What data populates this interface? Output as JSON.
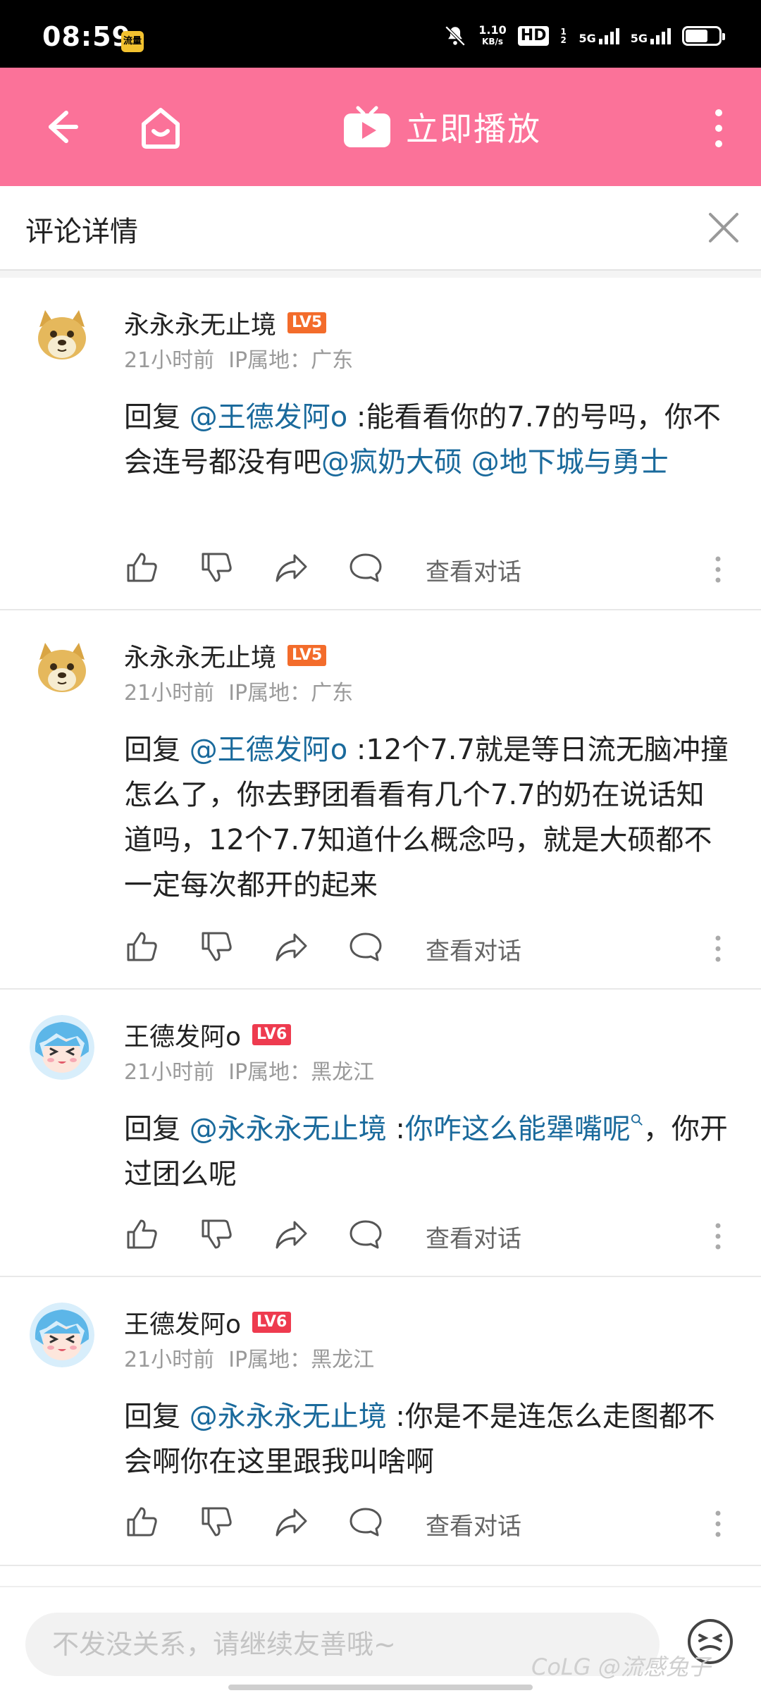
{
  "status": {
    "time": "08:59",
    "app_badge": "流量",
    "speed_value": "1.10",
    "speed_unit": "KB/s",
    "hd": "HD",
    "hd_sub": "1 2",
    "net1": "5G",
    "net2": "5G",
    "battery_level": 0.7
  },
  "app_bar": {
    "title": "立即播放",
    "background": "#fb7299"
  },
  "sub_header": {
    "title": "评论详情"
  },
  "comments": [
    {
      "username": "永永永无止境",
      "level": "LV5",
      "level_color": "#f36c2b",
      "time": "21小时前",
      "ip": "IP属地：广东",
      "reply_prefix": "回复 ",
      "mention": "@王德发阿o",
      "text_a": " :能看看你的7.7的号吗，你不会连号都没有吧",
      "mention2": "@疯奶大硕 @地下城与勇士",
      "text_b": "",
      "view_conversation": "查看对话",
      "avatar": "doge"
    },
    {
      "username": "永永永无止境",
      "level": "LV5",
      "level_color": "#f36c2b",
      "time": "21小时前",
      "ip": "IP属地：广东",
      "reply_prefix": "回复 ",
      "mention": "@王德发阿o",
      "text_a": " :12个7.7就是等日流无脑冲撞怎么了，你去野团看看有几个7.7的奶在说话知道吗，12个7.7知道什么概念吗，就是大硕都不一定每次都开的起来",
      "mention2": "",
      "text_b": "",
      "view_conversation": "查看对话",
      "avatar": "doge"
    },
    {
      "username": "王德发阿o",
      "level": "LV6",
      "level_color": "#ee3b4f",
      "time": "21小时前",
      "ip": "IP属地：黑龙江",
      "reply_prefix": "回复 ",
      "mention": "@永永永无止境",
      "text_a": " :",
      "mention2": "你咋这么能犟嘴呢",
      "text_b": "，你开过团么呢",
      "view_conversation": "查看对话",
      "avatar": "anime"
    },
    {
      "username": "王德发阿o",
      "level": "LV6",
      "level_color": "#ee3b4f",
      "time": "21小时前",
      "ip": "IP属地：黑龙江",
      "reply_prefix": "回复 ",
      "mention": "@永永永无止境",
      "text_a": " :你是不是连怎么走图都不会啊你在这里跟我叫啥啊",
      "mention2": "",
      "text_b": "",
      "view_conversation": "查看对话",
      "avatar": "anime"
    }
  ],
  "bottom": {
    "placeholder": "不发没关系，请继续友善哦~",
    "watermark": "CoLG @流感兔子"
  }
}
